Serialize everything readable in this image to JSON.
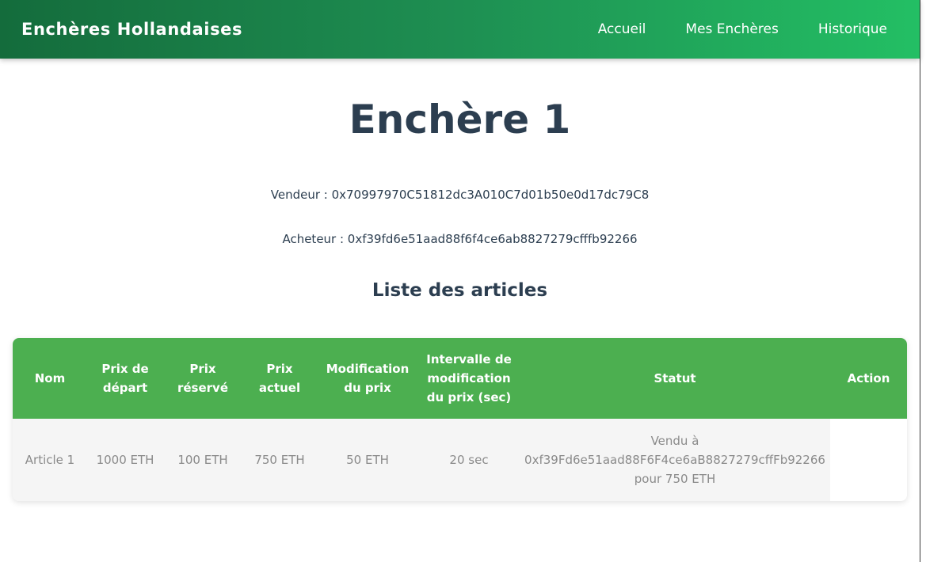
{
  "navbar": {
    "brand": "Enchères Hollandaises",
    "links": [
      "Accueil",
      "Mes Enchères",
      "Historique"
    ]
  },
  "auction": {
    "title": "Enchère 1",
    "seller_line": "Vendeur : 0x70997970C51812dc3A010C7d01b50e0d17dc79C8",
    "buyer_line": "Acheteur : 0xf39fd6e51aad88f6f4ce6ab8827279cfffb92266",
    "list_title": "Liste des articles"
  },
  "table": {
    "headers": [
      "Nom",
      "Prix de départ",
      "Prix réservé",
      "Prix actuel",
      "Modification du prix",
      "Intervalle de modification du prix (sec)",
      "Statut",
      "Action"
    ],
    "rows": [
      {
        "nom": "Article 1",
        "prix_depart": "1000 ETH",
        "prix_reserve": "100 ETH",
        "prix_actuel": "750 ETH",
        "modification": "50 ETH",
        "intervalle": "20 sec",
        "statut": "Vendu à 0xf39Fd6e51aad88F6F4ce6aB8827279cffFb92266 pour 750 ETH",
        "action": ""
      }
    ]
  },
  "colors": {
    "nav_gradient_start": "#146c3c",
    "nav_gradient_end": "#23bf64",
    "table_header": "#4caf50",
    "text_dark": "#2c3e50",
    "text_muted": "#8a8a8a"
  }
}
